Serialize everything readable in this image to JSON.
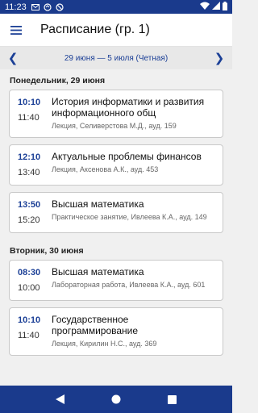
{
  "status_bar": {
    "time": "11:23",
    "icons": [
      "mail-icon",
      "sync-icon",
      "no-sim-icon"
    ],
    "right_icons": [
      "wifi-icon",
      "signal-icon",
      "battery-icon"
    ]
  },
  "app_bar": {
    "title": "Расписание (гр. 1)",
    "menu_icon": "hamburger-icon"
  },
  "week": {
    "label": "29 июня — 5 июля (Четная)",
    "prev": "❮",
    "next": "❯"
  },
  "days": [
    {
      "header": "Понедельник, 29 июня",
      "lessons": [
        {
          "start": "10:10",
          "end": "11:40",
          "subject": "История информатики и развития информационного общ",
          "details": "Лекция, Селиверстова М.Д., ауд. 159"
        },
        {
          "start": "12:10",
          "end": "13:40",
          "subject": "Актуальные проблемы финансов",
          "details": "Лекция, Аксенова А.К., ауд. 453"
        },
        {
          "start": "13:50",
          "end": "15:20",
          "subject": "Высшая математика",
          "details": "Практическое занятие, Ивлеева К.А., ауд. 149"
        }
      ]
    },
    {
      "header": "Вторник, 30 июня",
      "lessons": [
        {
          "start": "08:30",
          "end": "10:00",
          "subject": "Высшая математика",
          "details": "Лабораторная работа, Ивлеева К.А., ауд. 601"
        },
        {
          "start": "10:10",
          "end": "11:40",
          "subject": "Государственное программирование",
          "details": "Лекция, Кирилин Н.С., ауд. 369"
        }
      ]
    }
  ],
  "nav_bar": {
    "back": "back-triangle-icon",
    "home": "home-circle-icon",
    "recents": "recents-square-icon"
  },
  "colors": {
    "primary": "#1a3a8c",
    "accent": "#1b3f96"
  }
}
